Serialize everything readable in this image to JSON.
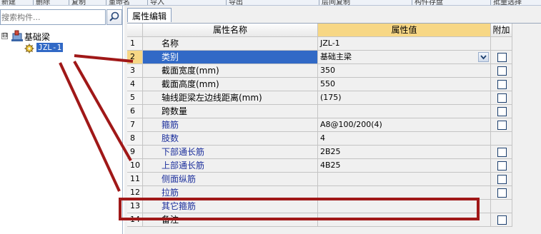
{
  "toolbar": {
    "items": [
      "新建",
      "删除",
      "复制",
      "重命名",
      "导入",
      "导出",
      "层间复制",
      "构件存盘",
      "批量选择"
    ]
  },
  "left": {
    "search_placeholder": "搜索构件...",
    "tree": {
      "root_label": "基础梁",
      "expander_symbol": "⊟",
      "child_label": "JZL-1"
    }
  },
  "right": {
    "tab_label": "属性编辑",
    "headers": {
      "name": "属性名称",
      "value": "属性值",
      "add": "附加"
    },
    "rows": [
      {
        "num": "1",
        "name": "名称",
        "value": "JZL-1",
        "blue": false,
        "check": false
      },
      {
        "num": "2",
        "name": "类别",
        "value": "基础主梁",
        "blue": false,
        "check": true,
        "selected": true,
        "dropdown": true
      },
      {
        "num": "3",
        "name": "截面宽度(mm)",
        "value": "350",
        "blue": false,
        "check": true
      },
      {
        "num": "4",
        "name": "截面高度(mm)",
        "value": "550",
        "blue": false,
        "check": true
      },
      {
        "num": "5",
        "name": "轴线距梁左边线距离(mm)",
        "value": "(175)",
        "blue": false,
        "check": true
      },
      {
        "num": "6",
        "name": "跨数量",
        "value": "",
        "blue": false,
        "check": true
      },
      {
        "num": "7",
        "name": "箍筋",
        "value": "A8@100/200(4)",
        "blue": true,
        "check": true
      },
      {
        "num": "8",
        "name": "肢数",
        "value": "4",
        "blue": true,
        "check": false
      },
      {
        "num": "9",
        "name": "下部通长筋",
        "value": "2B25",
        "blue": true,
        "check": true
      },
      {
        "num": "10",
        "name": "上部通长筋",
        "value": "4B25",
        "blue": true,
        "check": true
      },
      {
        "num": "11",
        "name": "侧面纵筋",
        "value": "",
        "blue": true,
        "check": true
      },
      {
        "num": "12",
        "name": "拉筋",
        "value": "",
        "blue": true,
        "check": true
      },
      {
        "num": "13",
        "name": "其它箍筋",
        "value": "",
        "blue": true,
        "check": false
      },
      {
        "num": "14",
        "name": "备注",
        "value": "",
        "blue": false,
        "check": true
      }
    ]
  },
  "annotation_color": "#a01818",
  "selection_color": "#3169c6",
  "header_value_color": "#f7d785"
}
